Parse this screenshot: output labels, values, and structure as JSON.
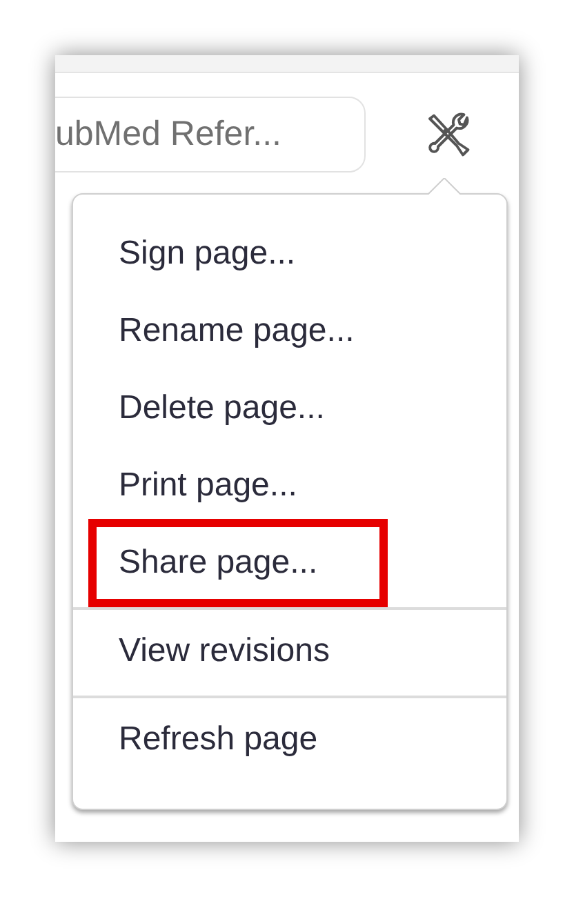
{
  "search": {
    "placeholder": "ubMed Refer..."
  },
  "menu": {
    "sections": [
      {
        "items": [
          {
            "label": "Sign page...",
            "highlighted": false
          },
          {
            "label": "Rename page...",
            "highlighted": false
          },
          {
            "label": "Delete page...",
            "highlighted": false
          },
          {
            "label": "Print page...",
            "highlighted": false
          },
          {
            "label": "Share page...",
            "highlighted": true
          }
        ]
      },
      {
        "items": [
          {
            "label": "View revisions",
            "highlighted": false
          }
        ]
      },
      {
        "items": [
          {
            "label": "Refresh page",
            "highlighted": false
          }
        ]
      }
    ]
  }
}
